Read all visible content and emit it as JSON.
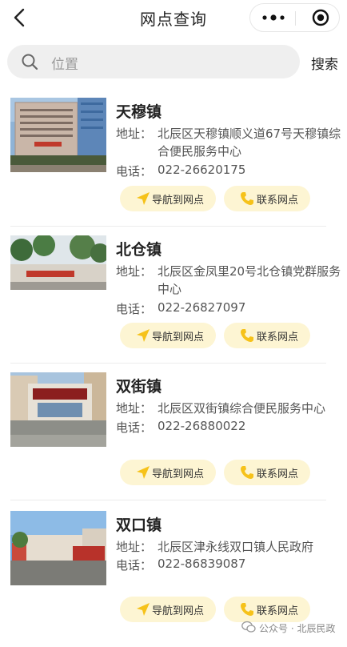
{
  "header": {
    "title": "网点查询",
    "back_icon": "chevron-left-icon",
    "more_icon": "more-dots-icon",
    "close_icon": "target-icon"
  },
  "search": {
    "placeholder": "位置",
    "button_label": "搜索"
  },
  "labels": {
    "address": "地址：",
    "phone": "电话："
  },
  "buttons": {
    "navigate": "导航到网点",
    "contact": "联系网点"
  },
  "colors": {
    "button_bg": "#fdf5d3",
    "icon_yellow": "#f6c21a"
  },
  "outlets": [
    {
      "name": "天穆镇",
      "address": "北辰区天穆镇顺义道67号天穆镇综合便民服务中心",
      "phone": "022-26620175"
    },
    {
      "name": "北仓镇",
      "address": "北辰区金凤里20号北仓镇党群服务中心",
      "phone": "022-26827097"
    },
    {
      "name": "双街镇",
      "address": "北辰区双街镇综合便民服务中心",
      "phone": "022-26880022"
    },
    {
      "name": "双口镇",
      "address": "北辰区津永线双口镇人民政府",
      "phone": "022-86839087"
    }
  ],
  "watermark": {
    "text": "公众号 · 北辰民政"
  }
}
